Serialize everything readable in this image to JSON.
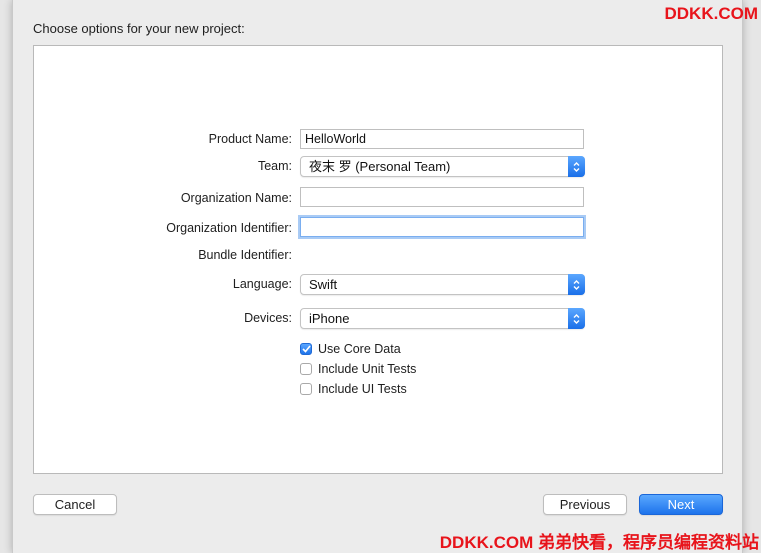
{
  "dialog": {
    "heading": "Choose options for your new project:"
  },
  "form": {
    "product_name": {
      "label": "Product Name:",
      "value": "HelloWorld"
    },
    "team": {
      "label": "Team:",
      "value": "夜末 罗 (Personal Team)"
    },
    "organization_name": {
      "label": "Organization Name:",
      "value": ""
    },
    "organization_identifier": {
      "label": "Organization Identifier:",
      "value": ""
    },
    "bundle_identifier": {
      "label": "Bundle Identifier:",
      "value": ""
    },
    "language": {
      "label": "Language:",
      "value": "Swift"
    },
    "devices": {
      "label": "Devices:",
      "value": "iPhone"
    },
    "options": [
      {
        "label": "Use Core Data",
        "checked": true
      },
      {
        "label": "Include Unit Tests",
        "checked": false
      },
      {
        "label": "Include UI Tests",
        "checked": false
      }
    ]
  },
  "buttons": {
    "cancel": "Cancel",
    "previous": "Previous",
    "next": "Next"
  },
  "watermark": {
    "top": "DDKK.COM",
    "bottom": "DDKK.COM 弟弟快看，程序员编程资料站"
  },
  "colors": {
    "accent": "#1d73ec",
    "watermark": "#e8141b"
  }
}
